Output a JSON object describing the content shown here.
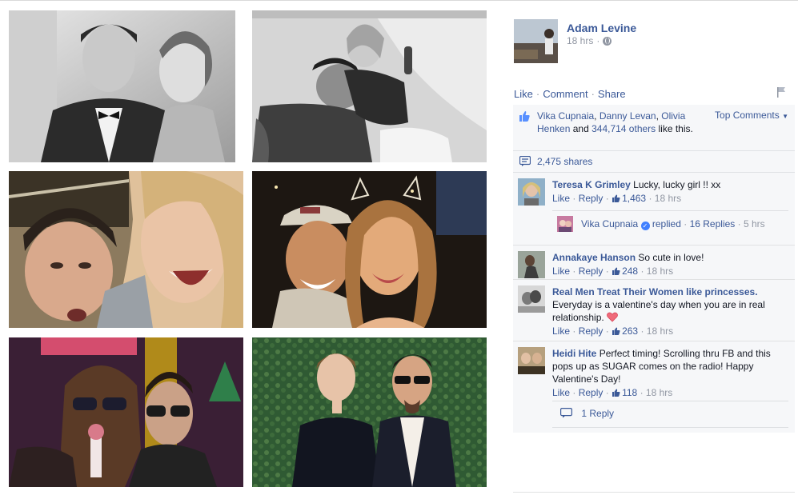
{
  "post": {
    "author": "Adam Levine",
    "time": "18 hrs",
    "meta_separator": "·",
    "actions": {
      "like": "Like",
      "comment": "Comment",
      "share": "Share",
      "separator": "·"
    }
  },
  "likes": {
    "name1": "Vika Cupnaia",
    "comma": ",",
    "name2": "Danny Levan",
    "name3": "Olivia Henken",
    "and": "and",
    "others": "344,714 others",
    "tail": "like this.",
    "top_comments": "Top Comments"
  },
  "shares": {
    "label": "2,475 shares"
  },
  "comments": [
    {
      "author": "Teresa K Grimley",
      "text": "Lucky, lucky girl !! xx",
      "like": "Like",
      "reply": "Reply",
      "likes": "1,463",
      "time": "18 hrs",
      "reply_thread": {
        "name": "Vika Cupnaia",
        "replied": "replied",
        "count": "16 Replies",
        "time": "5 hrs"
      }
    },
    {
      "author": "Annakaye Hanson",
      "text": "So cute in love!",
      "like": "Like",
      "reply": "Reply",
      "likes": "248",
      "time": "18 hrs"
    },
    {
      "author": "Real Men Treat Their Women like princesses.",
      "text": "Everyday is a valentine's day when you are in real relationship.",
      "like": "Like",
      "reply": "Reply",
      "likes": "263",
      "time": "18 hrs"
    },
    {
      "author": "Heidi Hite",
      "text": "Perfect timing! Scrolling thru FB and this pops up as SUGAR comes on the radio! Happy Valentine's Day!",
      "like": "Like",
      "reply": "Reply",
      "likes": "118",
      "time": "18 hrs",
      "reply_thread": {
        "count": "1 Reply"
      }
    }
  ],
  "footer_separator": "·",
  "colors": {
    "link": "#3b5998",
    "muted": "#9197a3",
    "ufi_bg": "#f6f7f9"
  },
  "icons": [
    "globe-icon",
    "flag-icon",
    "like-thumb-icon",
    "share-icon",
    "verified-icon",
    "heart-icon",
    "reply-icon",
    "dropdown-caret-icon"
  ]
}
